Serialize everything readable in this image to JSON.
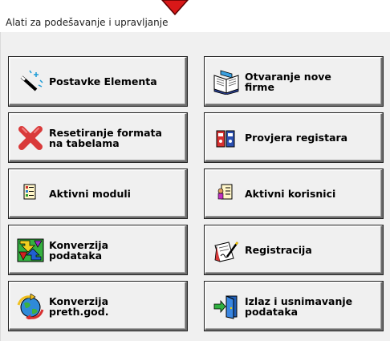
{
  "window": {
    "title": "Alati za podešavanje i upravljanje"
  },
  "buttons": {
    "postavke": {
      "label": "Postavke Elementa"
    },
    "otvaranje": {
      "label": "Otvaranje nove\nfirme"
    },
    "resetiranje": {
      "label": "Resetiranje formata\nna tabelama"
    },
    "provjera": {
      "label": "Provjera registara"
    },
    "aktivni_moduli": {
      "label": "Aktivni moduli"
    },
    "aktivni_korisnici": {
      "label": "Aktivni korisnici"
    },
    "konverzija_podataka": {
      "label": "Konverzija\npodataka"
    },
    "registracija": {
      "label": "Registracija"
    },
    "konverzija_preth": {
      "label": "Konverzija\npreth.god."
    },
    "izlaz": {
      "label": "Izlaz i usnimavanje\npodataka"
    }
  },
  "icons": {
    "postavke": "magic-wand-icon",
    "otvaranje": "open-book-icon",
    "resetiranje": "red-x-icon",
    "provjera": "binders-icon",
    "aktivni_moduli": "document-list-icon",
    "aktivni_korisnici": "users-document-icon",
    "konverzija_podataka": "conversion-arrows-icon",
    "registracija": "signed-document-icon",
    "konverzija_preth": "globe-arrows-icon",
    "izlaz": "exit-door-icon"
  },
  "colors": {
    "marker": "#e02020",
    "face": "#f0f0f0",
    "text": "#000000"
  }
}
